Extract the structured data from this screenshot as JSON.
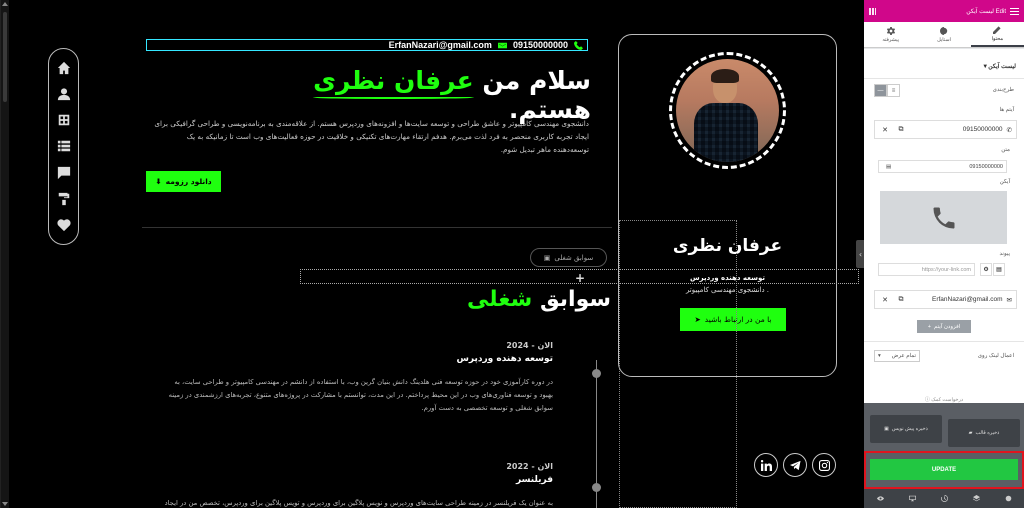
{
  "nav": {
    "items": [
      "home-icon",
      "user-icon",
      "portfolio-icon",
      "list-icon",
      "chat-icon",
      "paint-roller-icon",
      "heart-pulse-icon"
    ]
  },
  "contact": {
    "email": "ErfanNazari@gmail.com",
    "phone": "09150000000"
  },
  "hero": {
    "title_pre": "سلام من ",
    "title_highlight": "عرفان نظری",
    "title_post": " هستم.",
    "description": "دانشجوی مهندسی کامپیوتر و عاشق طراحی و توسعه سایت‌ها و افزونه‌های وردپرس هستم. از علاقه‌مندی به برنامه‌نویسی و طراحی گرافیکی برای ایجاد تجربه کاربری منحصر به فرد لذت می‌برم. هدفم ارتقاء مهارت‌های تکنیکی و خلاقیت در حوزه فعالیت‌های وب است تا زمانیکه به یک توسعه‌دهنده ماهر تبدیل شوم.",
    "download_label": "دانلود رزومه"
  },
  "profile": {
    "name": "عرفان نظری",
    "role": "توسعه دهنده وردپرس",
    "subtitle": ". دانشجوی مهندسی کامپیوتر",
    "contact_button": "با من در ارتباط باشید"
  },
  "experience": {
    "pill": "سوابق شغلی",
    "title_pre": "سوابق ",
    "title_highlight": "شغلی",
    "items": [
      {
        "date": "الان - 2024",
        "role": "توسعه دهنده وردپرس",
        "desc": "در دوره کارآموزی خود در حوزه توسعه فنی هلدینگ دانش بنیان گرین وب، با استفاده از دانشم در مهندسی کامپیوتر و طراحی سایت، به بهبود و توسعه فناوری‌های وب در این محیط پرداختم. در این مدت، توانستم با مشارکت در پروژه‌های متنوع، تجربه‌های ارزشمندی در زمینه سوابق شغلی و توسعه تخصصی به دست آورم."
      },
      {
        "date": "الان - 2022",
        "role": "فریلنسر",
        "desc": "به عنوان یک فریلنسر در زمینه طراحی سایت‌های وردپرس و نویس پلاگین برای وردپرس و تویس پلاگین برای وردپرس، تخصص من در ایجاد تجربه وب بی‌نظیر با"
      }
    ]
  },
  "socials": [
    "linkedin-icon",
    "telegram-icon",
    "instagram-icon"
  ],
  "panel": {
    "top_title": "Edit لیست آیکن",
    "tabs": [
      {
        "label": "محتوا",
        "icon": "pencil-icon"
      },
      {
        "label": "استایل",
        "icon": "half-circle-icon"
      },
      {
        "label": "پیشرفته",
        "icon": "gear-icon"
      }
    ],
    "section_title": "لیست آیکن",
    "layout_label": "طرح‌بندی",
    "items_label": "آیتم ها",
    "items": [
      {
        "text": "09150000000"
      },
      {
        "text": "ErfanNazari@gmail.com"
      }
    ],
    "text_label": "متن",
    "text_value": "09150000000",
    "icon_label": "آیکن",
    "link_label": "پیوند",
    "link_placeholder": "https://your-link.com",
    "add_item": "افزودن آیتم",
    "link_target_label": "اعمال لینک روی",
    "link_target_value": "تمام عرض",
    "need_help": "درخواست کمک",
    "save_template": "ذخیره قالب",
    "save_draft": "ذخیره پیش نویس",
    "update": "UPDATE"
  },
  "colors": {
    "accent": "#1fff0f",
    "panel_brand": "#d0078a",
    "update": "#22c742",
    "highlight_border": "#e0141e"
  }
}
